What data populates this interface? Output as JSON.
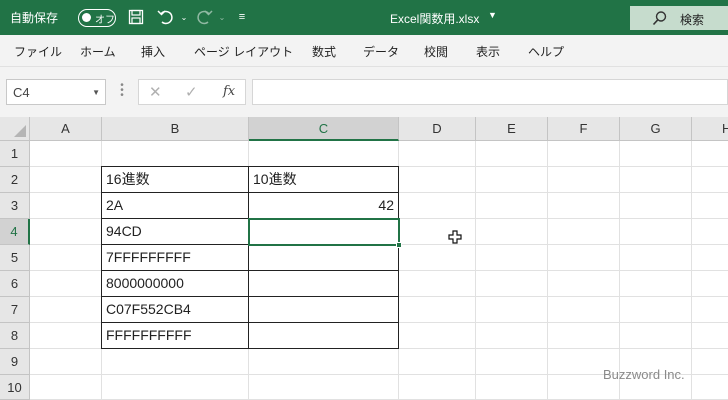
{
  "titlebar": {
    "autosave_label": "自動保存",
    "autosave_state": "オフ",
    "document_title": "Excel関数用.xlsx",
    "search_label": "検索",
    "icons": [
      "save-icon",
      "undo-icon",
      "redo-icon",
      "customize-icon",
      "search-icon"
    ],
    "brand_color": "#217346"
  },
  "ribbon": {
    "tabs": [
      "ファイル",
      "ホーム",
      "挿入",
      "ページ レイアウト",
      "数式",
      "データ",
      "校閲",
      "表示",
      "ヘルプ"
    ]
  },
  "formula_bar": {
    "name_box": "C4",
    "formula": ""
  },
  "sheet": {
    "columns": [
      "A",
      "B",
      "C",
      "D",
      "E",
      "F",
      "G",
      "H"
    ],
    "rows": [
      "1",
      "2",
      "3",
      "4",
      "5",
      "6",
      "7",
      "8",
      "9",
      "10"
    ],
    "selected_cell": "C4",
    "table": {
      "header_b": "16進数",
      "header_c": "10進数",
      "rows": [
        {
          "b": "2A",
          "c": "42"
        },
        {
          "b": "94CD",
          "c": ""
        },
        {
          "b": "7FFFFFFFFF",
          "c": ""
        },
        {
          "b": "8000000000",
          "c": ""
        },
        {
          "b": "C07F552CB4",
          "c": ""
        },
        {
          "b": "FFFFFFFFFF",
          "c": ""
        }
      ]
    }
  },
  "watermark": "Buzzword Inc."
}
